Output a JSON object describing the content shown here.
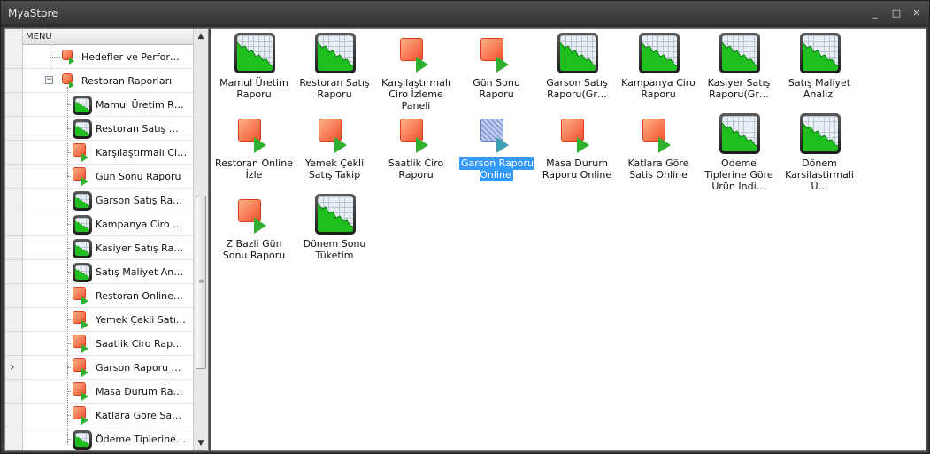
{
  "window": {
    "title": "MyaStore",
    "controls": [
      "_",
      "□",
      "✕"
    ]
  },
  "left_panel": {
    "column_header": "MENU",
    "rows": [
      {
        "label": "Hedefler ve Perfor…",
        "icon": "play-report-icon",
        "level": 1
      },
      {
        "label": "Restoran Raporları",
        "icon": "play-report-add-icon",
        "level": 1,
        "expanded": true
      },
      {
        "label": "Mamul Üretim R…",
        "icon": "chart-report-icon",
        "level": 2
      },
      {
        "label": "Restoran Satış …",
        "icon": "chart-report-icon",
        "level": 2
      },
      {
        "label": "Karşılaştırmalı Ci…",
        "icon": "play-report-icon",
        "level": 2
      },
      {
        "label": "Gün Sonu Raporu",
        "icon": "play-report-icon",
        "level": 2
      },
      {
        "label": "Garson Satış Ra…",
        "icon": "chart-report-icon",
        "level": 2
      },
      {
        "label": "Kampanya Ciro …",
        "icon": "chart-report-icon",
        "level": 2
      },
      {
        "label": "Kasiyer Satış Ra…",
        "icon": "chart-report-icon",
        "level": 2
      },
      {
        "label": "Satış Maliyet An…",
        "icon": "chart-report-icon",
        "level": 2
      },
      {
        "label": "Restoran Online…",
        "icon": "play-report-icon",
        "level": 2
      },
      {
        "label": "Yemek Çekli Satı…",
        "icon": "play-report-icon",
        "level": 2
      },
      {
        "label": "Saatlik Ciro Rap…",
        "icon": "play-report-icon",
        "level": 2
      },
      {
        "label": "Garson Raporu …",
        "icon": "play-report-icon",
        "level": 2,
        "current": true
      },
      {
        "label": "Masa Durum Ra…",
        "icon": "play-report-icon",
        "level": 2
      },
      {
        "label": "Katlara Göre Sa…",
        "icon": "play-report-icon",
        "level": 2
      },
      {
        "label": "Ödeme Tiplerine…",
        "icon": "chart-report-icon",
        "level": 2
      }
    ]
  },
  "right_panel": {
    "tiles": [
      {
        "label": "Mamul Üretim Raporu",
        "icon": "chart-report-icon"
      },
      {
        "label": "Restoran Satış Raporu",
        "icon": "chart-report-icon"
      },
      {
        "label": "Karşılaştırmalı Ciro İzleme Paneli",
        "icon": "play-report-icon"
      },
      {
        "label": "Gün Sonu Raporu",
        "icon": "play-report-icon"
      },
      {
        "label": "Garson Satış Raporu(Gr…",
        "icon": "chart-report-icon"
      },
      {
        "label": "Kampanya Ciro Raporu",
        "icon": "chart-report-icon"
      },
      {
        "label": "Kasiyer Satış Raporu(Gr…",
        "icon": "chart-report-icon"
      },
      {
        "label": "Satış Maliyet Analizi",
        "icon": "chart-report-icon"
      },
      {
        "label": "Restoran Online İzle",
        "icon": "play-report-icon"
      },
      {
        "label": "Yemek Çekli Satış Takip",
        "icon": "play-report-icon"
      },
      {
        "label": "Saatlik Ciro Raporu",
        "icon": "play-report-icon"
      },
      {
        "label": "Garson Raporu Online",
        "icon": "play-report-icon",
        "selected": true
      },
      {
        "label": "Masa Durum Raporu Online",
        "icon": "play-report-icon"
      },
      {
        "label": "Katlara Göre Satis Online",
        "icon": "play-report-icon"
      },
      {
        "label": "Ödeme Tiplerine Göre Ürün İndi…",
        "icon": "chart-report-icon"
      },
      {
        "label": "Dönem Karsilastirmali Ü…",
        "icon": "chart-report-icon"
      },
      {
        "label": "Z Bazli Gün Sonu Raporu",
        "icon": "play-report-icon"
      },
      {
        "label": "Dönem Sonu Tüketim",
        "icon": "chart-report-icon"
      }
    ]
  },
  "colors": {
    "selection": "#3399ff",
    "play_square": "#f0502a",
    "play_triangle": "#2fb02f",
    "chart_green": "#1fbf1f"
  }
}
